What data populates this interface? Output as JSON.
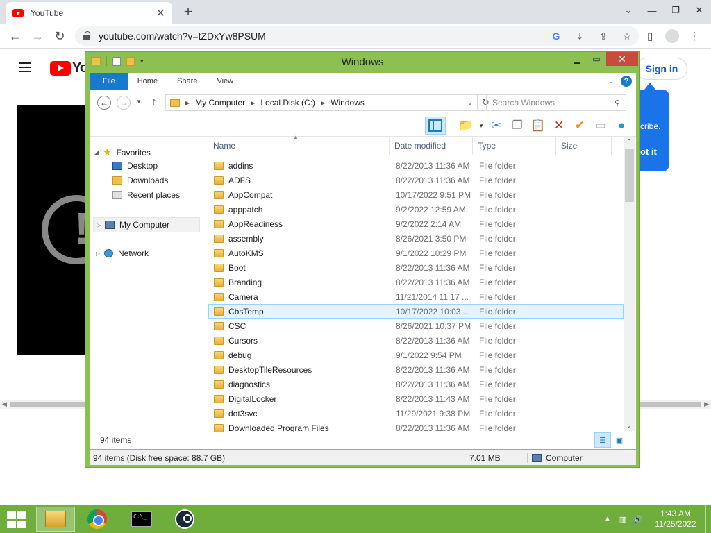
{
  "browser": {
    "tab_title": "YouTube",
    "tab_close": "✕",
    "new_tab": "+",
    "window_minimize": "⌄",
    "window_restore": "❐",
    "window_close": "✕",
    "url": "youtube.com/watch?v=tZDxYw8PSUM",
    "icons": [
      "back-icon",
      "forward-icon",
      "reload-icon",
      "lock-icon",
      "google-lens-icon",
      "install-icon",
      "share-icon",
      "star-icon",
      "sidebar-icon",
      "profile-icon",
      "menu-icon"
    ]
  },
  "youtube": {
    "wordmark": "Yo",
    "sign_in": "Sign in",
    "promo_text": "cribe.",
    "promo_button": "ot it"
  },
  "explorer": {
    "title": "Windows",
    "ribbon_tabs": [
      "File",
      "Home",
      "Share",
      "View"
    ],
    "help": "?",
    "breadcrumbs": [
      "My Computer",
      "Local Disk (C:)",
      "Windows"
    ],
    "search_placeholder": "Search Windows",
    "nav": {
      "favorites": "Favorites",
      "desktop": "Desktop",
      "downloads": "Downloads",
      "recent": "Recent places",
      "computer": "My Computer",
      "network": "Network"
    },
    "columns": [
      "Name",
      "Date modified",
      "Type",
      "Size"
    ],
    "files": [
      {
        "name": "addins",
        "date": "8/22/2013 11:36 AM",
        "type": "File folder"
      },
      {
        "name": "ADFS",
        "date": "8/22/2013 11:36 AM",
        "type": "File folder"
      },
      {
        "name": "AppCompat",
        "date": "10/17/2022 9:51 PM",
        "type": "File folder"
      },
      {
        "name": "apppatch",
        "date": "9/2/2022 12:59 AM",
        "type": "File folder"
      },
      {
        "name": "AppReadiness",
        "date": "9/2/2022 2:14 AM",
        "type": "File folder"
      },
      {
        "name": "assembly",
        "date": "8/26/2021 3:50 PM",
        "type": "File folder"
      },
      {
        "name": "AutoKMS",
        "date": "9/1/2022 10:29 PM",
        "type": "File folder"
      },
      {
        "name": "Boot",
        "date": "8/22/2013 11:36 AM",
        "type": "File folder"
      },
      {
        "name": "Branding",
        "date": "8/22/2013 11:36 AM",
        "type": "File folder"
      },
      {
        "name": "Camera",
        "date": "11/21/2014 11:17 ...",
        "type": "File folder"
      },
      {
        "name": "CbsTemp",
        "date": "10/17/2022 10:03 ...",
        "type": "File folder",
        "selected": true
      },
      {
        "name": "CSC",
        "date": "8/26/2021 10:37 PM",
        "type": "File folder"
      },
      {
        "name": "Cursors",
        "date": "8/22/2013 11:36 AM",
        "type": "File folder"
      },
      {
        "name": "debug",
        "date": "9/1/2022 9:54 PM",
        "type": "File folder"
      },
      {
        "name": "DesktopTileResources",
        "date": "8/22/2013 11:36 AM",
        "type": "File folder"
      },
      {
        "name": "diagnostics",
        "date": "8/22/2013 11:36 AM",
        "type": "File folder"
      },
      {
        "name": "DigitalLocker",
        "date": "8/22/2013 11:43 AM",
        "type": "File folder"
      },
      {
        "name": "dot3svc",
        "date": "11/29/2021 9:38 PM",
        "type": "File folder"
      },
      {
        "name": "Downloaded Program Files",
        "date": "8/22/2013 11:36 AM",
        "type": "File folder"
      }
    ],
    "items_count": "94 items",
    "status_left": "94 items (Disk free space: 88.7 GB)",
    "status_size": "7.01 MB",
    "status_location": "Computer"
  },
  "taskbar": {
    "apps": [
      "file-explorer",
      "chrome",
      "command-prompt",
      "steam"
    ],
    "time": "1:43 AM",
    "date": "11/25/2022"
  },
  "colors": {
    "explorer_frame": "#8cc152",
    "taskbar": "#6fae3c",
    "ribbon_file": "#1979ca",
    "selection": "#e5f3ff",
    "youtube_red": "#ff0000"
  }
}
